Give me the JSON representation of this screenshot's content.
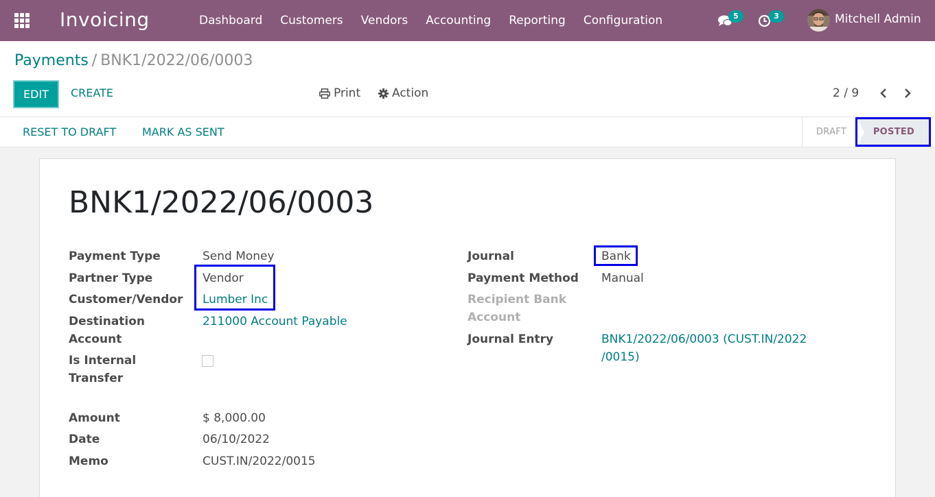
{
  "navbar": {
    "app_name": "Invoicing",
    "menu": [
      "Dashboard",
      "Customers",
      "Vendors",
      "Accounting",
      "Reporting",
      "Configuration"
    ],
    "messages_count": "5",
    "activities_count": "3",
    "user_name": "Mitchell Admin",
    "colors": {
      "navbar": "#875a7b",
      "badge": "#00a09d"
    }
  },
  "breadcrumb": {
    "parent": "Payments",
    "separator": "/",
    "current": "BNK1/2022/06/0003"
  },
  "toolbar": {
    "edit_label": "EDIT",
    "create_label": "CREATE",
    "print_label": "Print",
    "action_label": "Action",
    "pager": "2 / 9"
  },
  "statusbar": {
    "reset_label": "RESET TO DRAFT",
    "mark_sent_label": "MARK AS SENT",
    "steps": [
      "DRAFT",
      "POSTED"
    ],
    "active_step": "POSTED"
  },
  "record": {
    "name": "BNK1/2022/06/0003",
    "left_fields": [
      {
        "label": "Payment Type",
        "value": "Send Money"
      },
      {
        "label": "Partner Type",
        "value": "Vendor"
      },
      {
        "label": "Customer/Vendor",
        "value": "Lumber Inc"
      },
      {
        "label_1": "Destination",
        "label_2": "Account",
        "value": "211000 Account Payable"
      },
      {
        "label_1": "Is Internal",
        "label_2": "Transfer",
        "checked": false
      }
    ],
    "amount_fields": [
      {
        "label": "Amount",
        "value": "$ 8,000.00"
      },
      {
        "label": "Date",
        "value": "06/10/2022"
      },
      {
        "label": "Memo",
        "value": "CUST.IN/2022/0015"
      }
    ],
    "right_fields": [
      {
        "label": "Journal",
        "value": "Bank"
      },
      {
        "label": "Payment Method",
        "value": "Manual"
      },
      {
        "label_1": "Recipient Bank",
        "label_2": "Account",
        "value": ""
      },
      {
        "label": "Journal Entry",
        "value_1": "BNK1/2022/06/0003 (CUST.IN/2022",
        "value_2": "/0015)"
      }
    ]
  },
  "icons": [
    "apps-icon",
    "chat-icon",
    "clock-icon",
    "print-icon",
    "gear-icon",
    "chevron-left-icon",
    "chevron-right-icon"
  ]
}
